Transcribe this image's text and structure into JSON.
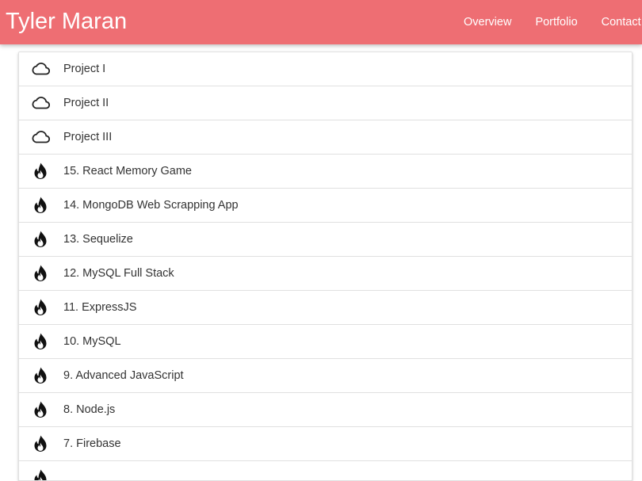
{
  "header": {
    "brand": "Tyler Maran",
    "nav": [
      "Overview",
      "Portfolio",
      "Contact"
    ],
    "background_color": "#ee6e73"
  },
  "projects": [
    {
      "label": "Project I",
      "icon": "cloud-icon"
    },
    {
      "label": "Project II",
      "icon": "cloud-icon"
    },
    {
      "label": "Project III",
      "icon": "cloud-icon"
    },
    {
      "label": "15. React Memory Game",
      "icon": "fire-icon"
    },
    {
      "label": "14. MongoDB Web Scrapping App",
      "icon": "fire-icon"
    },
    {
      "label": "13. Sequelize",
      "icon": "fire-icon"
    },
    {
      "label": "12. MySQL Full Stack",
      "icon": "fire-icon"
    },
    {
      "label": "11. ExpressJS",
      "icon": "fire-icon"
    },
    {
      "label": "10. MySQL",
      "icon": "fire-icon"
    },
    {
      "label": "9. Advanced JavaScript",
      "icon": "fire-icon"
    },
    {
      "label": "8. Node.js",
      "icon": "fire-icon"
    },
    {
      "label": "7. Firebase",
      "icon": "fire-icon"
    },
    {
      "label": "",
      "icon": "fire-icon"
    }
  ]
}
